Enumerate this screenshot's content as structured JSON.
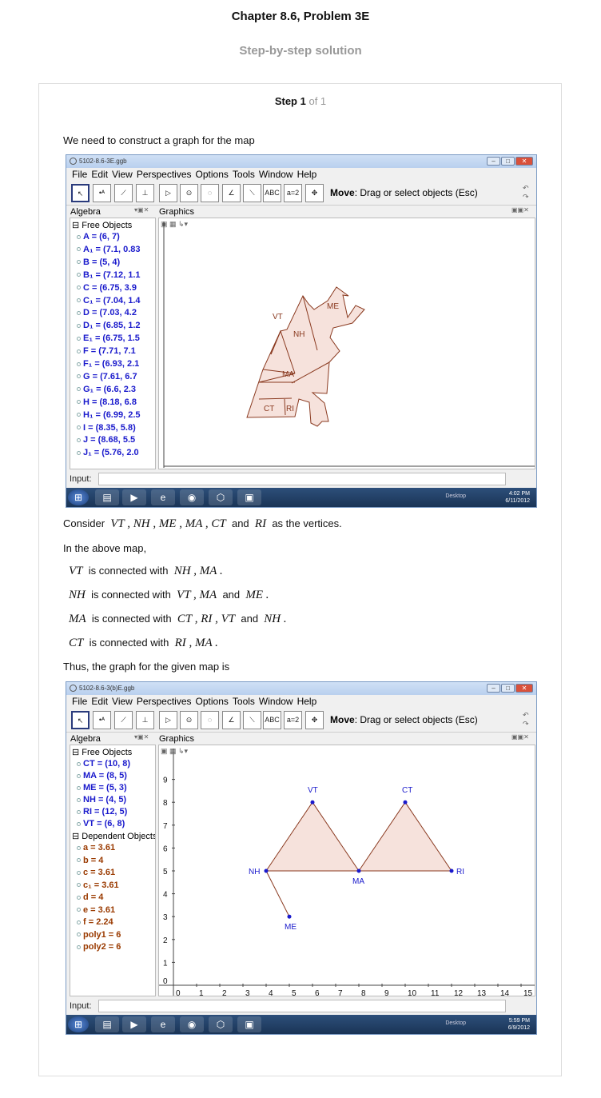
{
  "header": {
    "title": "Chapter 8.6, Problem 3E",
    "subtitle": "Step-by-step solution",
    "step_label": "Step 1",
    "step_of": "of 1"
  },
  "text": {
    "intro": "We need to construct a graph for the map",
    "consider_pre": "Consider",
    "consider_vertices": "VT , NH , ME , MA , CT",
    "consider_and": "and",
    "consider_ri": "RI",
    "consider_post": "as the vertices.",
    "in_map": "In the above map,",
    "conn": [
      {
        "v": "VT",
        "mid": "is connected with",
        "list": "NH , MA .",
        "and": "",
        "last": ""
      },
      {
        "v": "NH",
        "mid": "is connected with",
        "list": "VT , MA",
        "and": "and",
        "last": "ME ."
      },
      {
        "v": "MA",
        "mid": "is connected with",
        "list": "CT , RI , VT",
        "and": "and",
        "last": "NH ."
      },
      {
        "v": "CT",
        "mid": "is connected with",
        "list": "RI , MA .",
        "and": "",
        "last": ""
      }
    ],
    "thus": "Thus, the graph for the given map is"
  },
  "window1": {
    "title": "5102-8.6-3E.ggb",
    "menu": [
      "File",
      "Edit",
      "View",
      "Perspectives",
      "Options",
      "Tools",
      "Window",
      "Help"
    ],
    "move_bold": "Move",
    "move_rest": ": Drag or select objects (Esc)",
    "algebra_label": "Algebra",
    "graphics_label": "Graphics",
    "free_objects": "Free Objects",
    "items": [
      "A = (6, 7)",
      "A₁ = (7.1, 0.83",
      "B = (5, 4)",
      "B₁ = (7.12, 1.1",
      "C = (6.75, 3.9",
      "C₁ = (7.04, 1.4",
      "D = (7.03, 4.2",
      "D₁ = (6.85, 1.2",
      "E₁ = (6.75, 1.5",
      "F = (7.71, 7.1",
      "F₁ = (6.93, 2.1",
      "G = (7.61, 6.7",
      "G₁ = (6.6, 2.3",
      "H = (8.18, 6.8",
      "H₁ = (6.99, 2.5",
      "I = (8.35, 5.8)",
      "J = (8.68, 5.5",
      "J₁ = (5.76, 2.0"
    ],
    "states": [
      "VT",
      "ME",
      "NH",
      "MA",
      "CT",
      "RI"
    ],
    "input_label": "Input:",
    "desktop": "Desktop",
    "clock_time": "4:02 PM",
    "clock_date": "6/11/2012"
  },
  "window2": {
    "title": "5102-8.6-3(b)E.ggb",
    "menu": [
      "File",
      "Edit",
      "View",
      "Perspectives",
      "Options",
      "Tools",
      "Window",
      "Help"
    ],
    "move_bold": "Move",
    "move_rest": ": Drag or select objects (Esc)",
    "algebra_label": "Algebra",
    "graphics_label": "Graphics",
    "free_objects": "Free Objects",
    "free_items": [
      "CT = (10, 8)",
      "MA = (8, 5)",
      "ME = (5, 3)",
      "NH = (4, 5)",
      "RI = (12, 5)",
      "VT = (6, 8)"
    ],
    "dependent_objects": "Dependent Objects",
    "dep_items": [
      "a = 3.61",
      "b = 4",
      "c = 3.61",
      "c₁ = 3.61",
      "d = 4",
      "e = 3.61",
      "f = 2.24",
      "poly1 = 6",
      "poly2 = 6"
    ],
    "x_ticks": [
      "0",
      "1",
      "2",
      "3",
      "4",
      "5",
      "6",
      "7",
      "8",
      "9",
      "10",
      "11",
      "12",
      "13",
      "14",
      "15"
    ],
    "y_ticks": [
      "0",
      "1",
      "2",
      "3",
      "4",
      "5",
      "6",
      "7",
      "8",
      "9"
    ],
    "vertices": [
      {
        "name": "VT",
        "x": 6,
        "y": 8
      },
      {
        "name": "CT",
        "x": 10,
        "y": 8
      },
      {
        "name": "NH",
        "x": 4,
        "y": 5
      },
      {
        "name": "MA",
        "x": 8,
        "y": 5
      },
      {
        "name": "RI",
        "x": 12,
        "y": 5
      },
      {
        "name": "ME",
        "x": 5,
        "y": 3
      }
    ],
    "input_label": "Input:",
    "desktop": "Desktop",
    "clock_time": "5:59 PM",
    "clock_date": "6/9/2012"
  },
  "colors": {
    "point": "#1a1acc",
    "poly_fill": "#f6e2dc",
    "poly_stroke": "#8a3a20",
    "dependent": "#9a3a00"
  }
}
